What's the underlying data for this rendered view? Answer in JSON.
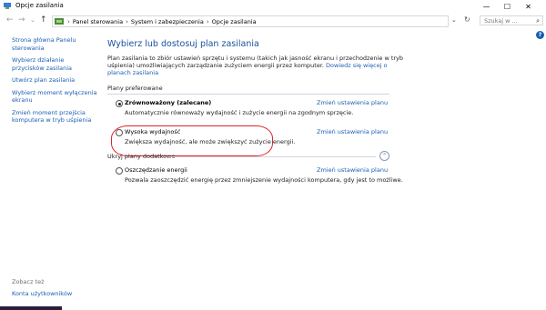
{
  "window": {
    "title": "Opcje zasilania",
    "minimize_glyph": "—",
    "maximize_glyph": "☐",
    "close_glyph": "✕"
  },
  "nav": {
    "back_glyph": "←",
    "forward_glyph": "→",
    "dropdown_glyph": "⌄",
    "up_glyph": "↑",
    "breadcrumbs": [
      "Panel sterowania",
      "System i zabezpieczenia",
      "Opcje zasilania"
    ],
    "separator": "›",
    "history_glyph": "⌄",
    "refresh_glyph": "↻",
    "search_placeholder": "Szukaj w ...",
    "search_glyph": "⌕"
  },
  "sidebar": {
    "items": [
      "Strona główna Panelu sterowania",
      "Wybierz działanie przycisków zasilania",
      "Utwórz plan zasilania",
      "Wybierz moment wyłączenia ekranu",
      "Zmień moment przejścia komputera w tryb uśpienia"
    ],
    "see_also_label": "Zobacz też",
    "bottom_link": "Konta użytkowników"
  },
  "main": {
    "heading": "Wybierz lub dostosuj plan zasilania",
    "intro_text": "Plan zasilania to zbiór ustawień sprzętu i systemu (takich jak jasność ekranu i przechodzenie w tryb uśpienia) umożliwiających zarządzanie zużyciem energii przez komputer. ",
    "intro_link": "Dowiedz się więcej o planach zasilania",
    "preferred_label": "Plany preferowane",
    "plans": [
      {
        "name": "Zrównoważony (zalecane)",
        "description": "Automatycznie równoważy wydajność i zużycie energii na zgodnym sprzęcie.",
        "link": "Zmień ustawienia planu",
        "selected": true
      },
      {
        "name": "Wysoka wydajność",
        "description": "Zwiększa wydajność, ale może zwiększyć zużycie energii.",
        "link": "Zmień ustawienia planu",
        "selected": false
      }
    ],
    "hidden_label": "Ukryj plany dodatkowe",
    "collapse_glyph": "⌃",
    "extra_plan": {
      "name": "Oszczędzanie energii",
      "description": "Pozwala zaoszczędzić energię przez zmniejszenie wydajności komputera, gdy jest to możliwe.",
      "link": "Zmień ustawienia planu",
      "selected": false
    }
  },
  "help_glyph": "?",
  "colors": {
    "link": "#1a5fb4",
    "heading": "#1a4fa0",
    "annotation": "#e02424"
  }
}
